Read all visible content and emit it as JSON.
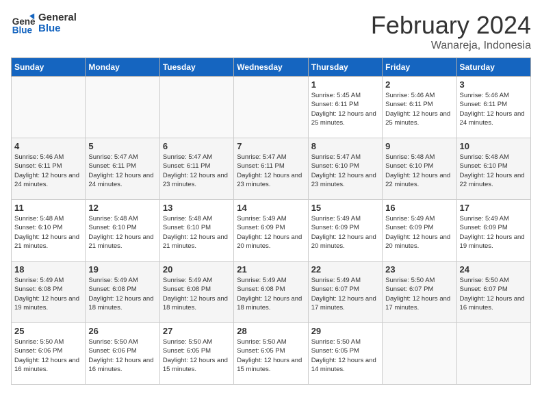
{
  "header": {
    "logo_general": "General",
    "logo_blue": "Blue",
    "month_title": "February 2024",
    "location": "Wanareja, Indonesia"
  },
  "days_of_week": [
    "Sunday",
    "Monday",
    "Tuesday",
    "Wednesday",
    "Thursday",
    "Friday",
    "Saturday"
  ],
  "weeks": [
    [
      {
        "day": "",
        "info": ""
      },
      {
        "day": "",
        "info": ""
      },
      {
        "day": "",
        "info": ""
      },
      {
        "day": "",
        "info": ""
      },
      {
        "day": "1",
        "info": "Sunrise: 5:45 AM\nSunset: 6:11 PM\nDaylight: 12 hours\nand 25 minutes."
      },
      {
        "day": "2",
        "info": "Sunrise: 5:46 AM\nSunset: 6:11 PM\nDaylight: 12 hours\nand 25 minutes."
      },
      {
        "day": "3",
        "info": "Sunrise: 5:46 AM\nSunset: 6:11 PM\nDaylight: 12 hours\nand 24 minutes."
      }
    ],
    [
      {
        "day": "4",
        "info": "Sunrise: 5:46 AM\nSunset: 6:11 PM\nDaylight: 12 hours\nand 24 minutes."
      },
      {
        "day": "5",
        "info": "Sunrise: 5:47 AM\nSunset: 6:11 PM\nDaylight: 12 hours\nand 24 minutes."
      },
      {
        "day": "6",
        "info": "Sunrise: 5:47 AM\nSunset: 6:11 PM\nDaylight: 12 hours\nand 23 minutes."
      },
      {
        "day": "7",
        "info": "Sunrise: 5:47 AM\nSunset: 6:11 PM\nDaylight: 12 hours\nand 23 minutes."
      },
      {
        "day": "8",
        "info": "Sunrise: 5:47 AM\nSunset: 6:10 PM\nDaylight: 12 hours\nand 23 minutes."
      },
      {
        "day": "9",
        "info": "Sunrise: 5:48 AM\nSunset: 6:10 PM\nDaylight: 12 hours\nand 22 minutes."
      },
      {
        "day": "10",
        "info": "Sunrise: 5:48 AM\nSunset: 6:10 PM\nDaylight: 12 hours\nand 22 minutes."
      }
    ],
    [
      {
        "day": "11",
        "info": "Sunrise: 5:48 AM\nSunset: 6:10 PM\nDaylight: 12 hours\nand 21 minutes."
      },
      {
        "day": "12",
        "info": "Sunrise: 5:48 AM\nSunset: 6:10 PM\nDaylight: 12 hours\nand 21 minutes."
      },
      {
        "day": "13",
        "info": "Sunrise: 5:48 AM\nSunset: 6:10 PM\nDaylight: 12 hours\nand 21 minutes."
      },
      {
        "day": "14",
        "info": "Sunrise: 5:49 AM\nSunset: 6:09 PM\nDaylight: 12 hours\nand 20 minutes."
      },
      {
        "day": "15",
        "info": "Sunrise: 5:49 AM\nSunset: 6:09 PM\nDaylight: 12 hours\nand 20 minutes."
      },
      {
        "day": "16",
        "info": "Sunrise: 5:49 AM\nSunset: 6:09 PM\nDaylight: 12 hours\nand 20 minutes."
      },
      {
        "day": "17",
        "info": "Sunrise: 5:49 AM\nSunset: 6:09 PM\nDaylight: 12 hours\nand 19 minutes."
      }
    ],
    [
      {
        "day": "18",
        "info": "Sunrise: 5:49 AM\nSunset: 6:08 PM\nDaylight: 12 hours\nand 19 minutes."
      },
      {
        "day": "19",
        "info": "Sunrise: 5:49 AM\nSunset: 6:08 PM\nDaylight: 12 hours\nand 18 minutes."
      },
      {
        "day": "20",
        "info": "Sunrise: 5:49 AM\nSunset: 6:08 PM\nDaylight: 12 hours\nand 18 minutes."
      },
      {
        "day": "21",
        "info": "Sunrise: 5:49 AM\nSunset: 6:08 PM\nDaylight: 12 hours\nand 18 minutes."
      },
      {
        "day": "22",
        "info": "Sunrise: 5:49 AM\nSunset: 6:07 PM\nDaylight: 12 hours\nand 17 minutes."
      },
      {
        "day": "23",
        "info": "Sunrise: 5:50 AM\nSunset: 6:07 PM\nDaylight: 12 hours\nand 17 minutes."
      },
      {
        "day": "24",
        "info": "Sunrise: 5:50 AM\nSunset: 6:07 PM\nDaylight: 12 hours\nand 16 minutes."
      }
    ],
    [
      {
        "day": "25",
        "info": "Sunrise: 5:50 AM\nSunset: 6:06 PM\nDaylight: 12 hours\nand 16 minutes."
      },
      {
        "day": "26",
        "info": "Sunrise: 5:50 AM\nSunset: 6:06 PM\nDaylight: 12 hours\nand 16 minutes."
      },
      {
        "day": "27",
        "info": "Sunrise: 5:50 AM\nSunset: 6:05 PM\nDaylight: 12 hours\nand 15 minutes."
      },
      {
        "day": "28",
        "info": "Sunrise: 5:50 AM\nSunset: 6:05 PM\nDaylight: 12 hours\nand 15 minutes."
      },
      {
        "day": "29",
        "info": "Sunrise: 5:50 AM\nSunset: 6:05 PM\nDaylight: 12 hours\nand 14 minutes."
      },
      {
        "day": "",
        "info": ""
      },
      {
        "day": "",
        "info": ""
      }
    ]
  ]
}
